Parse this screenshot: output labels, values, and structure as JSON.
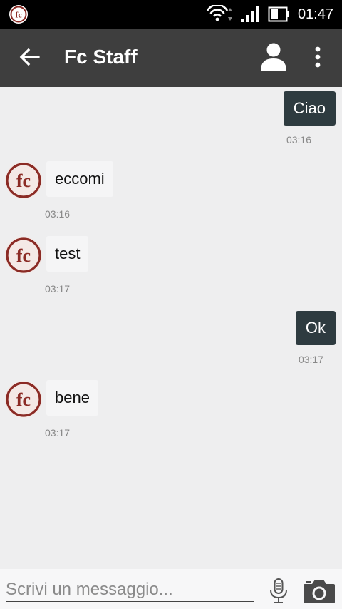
{
  "status_bar": {
    "time": "01:47"
  },
  "header": {
    "title": "Fc Staff"
  },
  "avatar_text": "fc",
  "messages": [
    {
      "direction": "out",
      "text": "Ciao",
      "time": "03:16"
    },
    {
      "direction": "in",
      "text": "eccomi",
      "time": "03:16"
    },
    {
      "direction": "in",
      "text": "test",
      "time": "03:17"
    },
    {
      "direction": "out",
      "text": "Ok",
      "time": "03:17"
    },
    {
      "direction": "in",
      "text": "bene",
      "time": "03:17"
    }
  ],
  "composer": {
    "placeholder": "Scrivi un messaggio..."
  },
  "icons": {
    "app": "fc-app-icon",
    "wifi": "wifi-icon",
    "signal": "signal-icon",
    "battery": "battery-icon",
    "back": "arrow-back-icon",
    "profile": "person-icon",
    "menu": "more-vert-icon",
    "mic": "microphone-icon",
    "camera": "camera-icon"
  },
  "colors": {
    "header_bg": "#3e3e3e",
    "outgoing_bubble": "#2e3b40",
    "avatar_red": "#8b2b25",
    "chat_bg": "#eeeeef"
  }
}
